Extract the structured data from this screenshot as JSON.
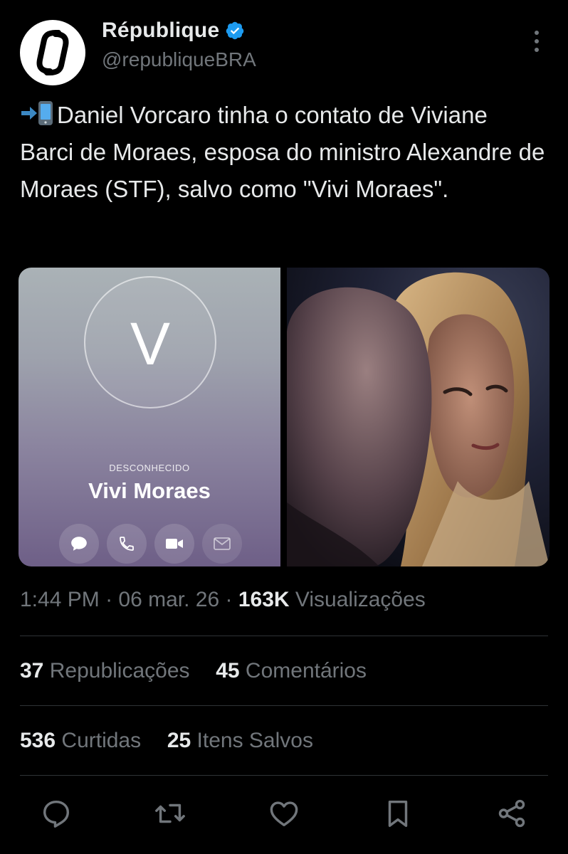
{
  "author": {
    "display_name": "République",
    "handle": "@republiqueBRA",
    "verified": true,
    "avatar_icon": "republique-logo-icon"
  },
  "tweet": {
    "emoji_icon": "mobile-phone-arrow-icon",
    "text": "Daniel Vorcaro tinha o contato de Viviane Barci de Moraes, esposa do ministro Alexandre de Moraes (STF), salvo como \"Vivi Moraes\"."
  },
  "media": {
    "contact_card": {
      "initial": "V",
      "status": "DESCONHECIDO",
      "name": "Vivi Moraes",
      "actions": [
        "message-icon",
        "phone-icon",
        "video-icon",
        "mail-icon"
      ]
    },
    "photo": "photo of a man and a woman"
  },
  "meta": {
    "time": "1:44 PM",
    "separator": " · ",
    "date": "06 mar. 26",
    "views_count": "163K",
    "views_label": "Visualizações"
  },
  "stats": {
    "reposts_count": "37",
    "reposts_label": "Republicações",
    "comments_count": "45",
    "comments_label": "Comentários",
    "likes_count": "536",
    "likes_label": "Curtidas",
    "saves_count": "25",
    "saves_label": "Itens Salvos"
  },
  "colors": {
    "background": "#000000",
    "text": "#e7e9ea",
    "muted": "#71767b",
    "verified": "#1d9bf0"
  }
}
